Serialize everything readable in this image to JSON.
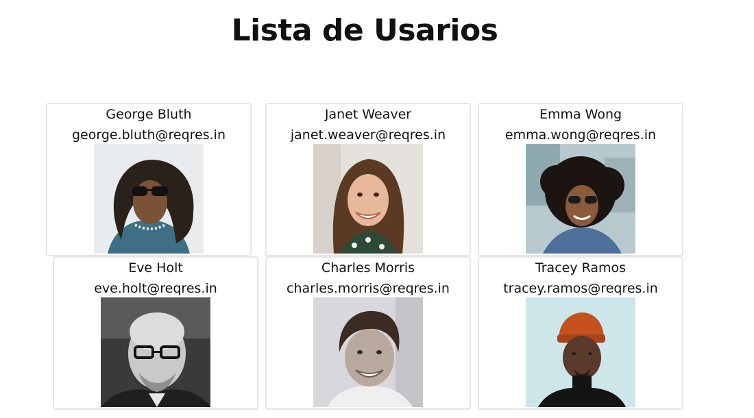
{
  "page": {
    "title": "Lista de Usarios"
  },
  "users": [
    {
      "name": "George Bluth",
      "email": "george.bluth@reqres.in",
      "avatar_icon": "avatar-photo-icon"
    },
    {
      "name": "Janet Weaver",
      "email": "janet.weaver@reqres.in",
      "avatar_icon": "avatar-photo-icon"
    },
    {
      "name": "Emma Wong",
      "email": "emma.wong@reqres.in",
      "avatar_icon": "avatar-photo-icon"
    },
    {
      "name": "Eve Holt",
      "email": "eve.holt@reqres.in",
      "avatar_icon": "avatar-photo-icon"
    },
    {
      "name": "Charles Morris",
      "email": "charles.morris@reqres.in",
      "avatar_icon": "avatar-photo-icon"
    },
    {
      "name": "Tracey Ramos",
      "email": "tracey.ramos@reqres.in",
      "avatar_icon": "avatar-photo-icon"
    }
  ],
  "colors": {
    "card_border": "#e6e6e6",
    "text": "#111111",
    "background": "#ffffff"
  }
}
